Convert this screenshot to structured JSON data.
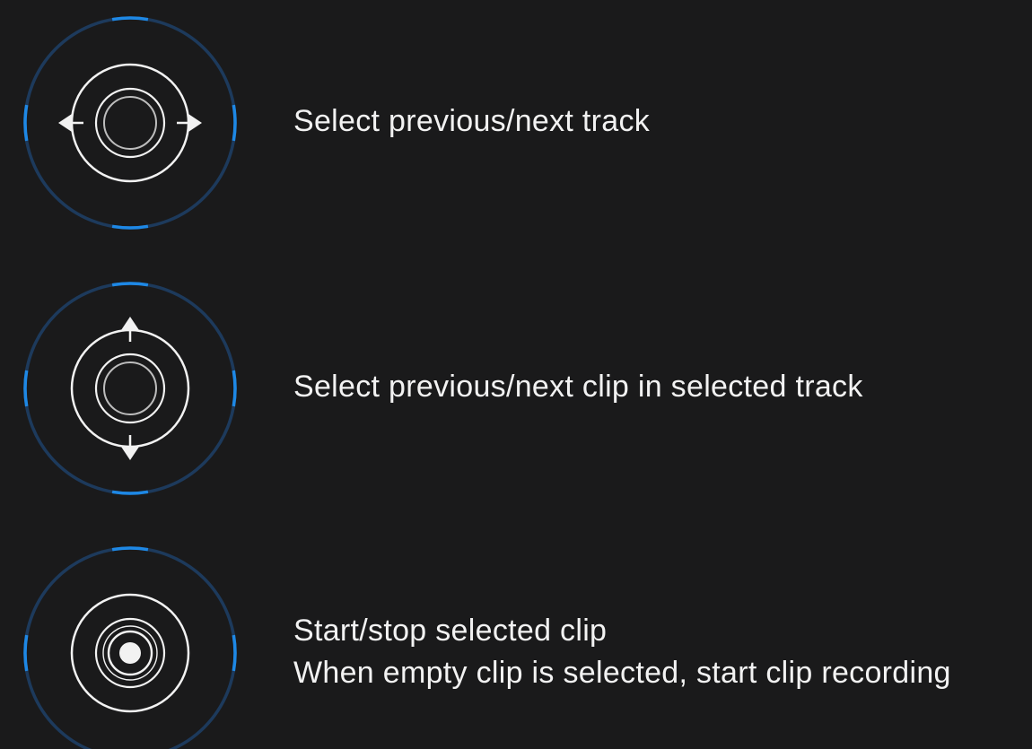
{
  "colors": {
    "background": "#1a1a1b",
    "dial_track": "#1d3a5c",
    "dial_accent": "#1e88e5",
    "icon_stroke": "#f2f2f2",
    "inner_stroke": "#bdbdbd",
    "text": "#f2f2f2"
  },
  "gestures": [
    {
      "icon": "joystick-left-right-icon",
      "lines": [
        "Select previous/next track"
      ]
    },
    {
      "icon": "joystick-up-down-icon",
      "lines": [
        "Select previous/next clip in selected track"
      ]
    },
    {
      "icon": "joystick-press-icon",
      "lines": [
        "Start/stop selected clip",
        "When empty clip is selected, start clip recording"
      ]
    }
  ]
}
